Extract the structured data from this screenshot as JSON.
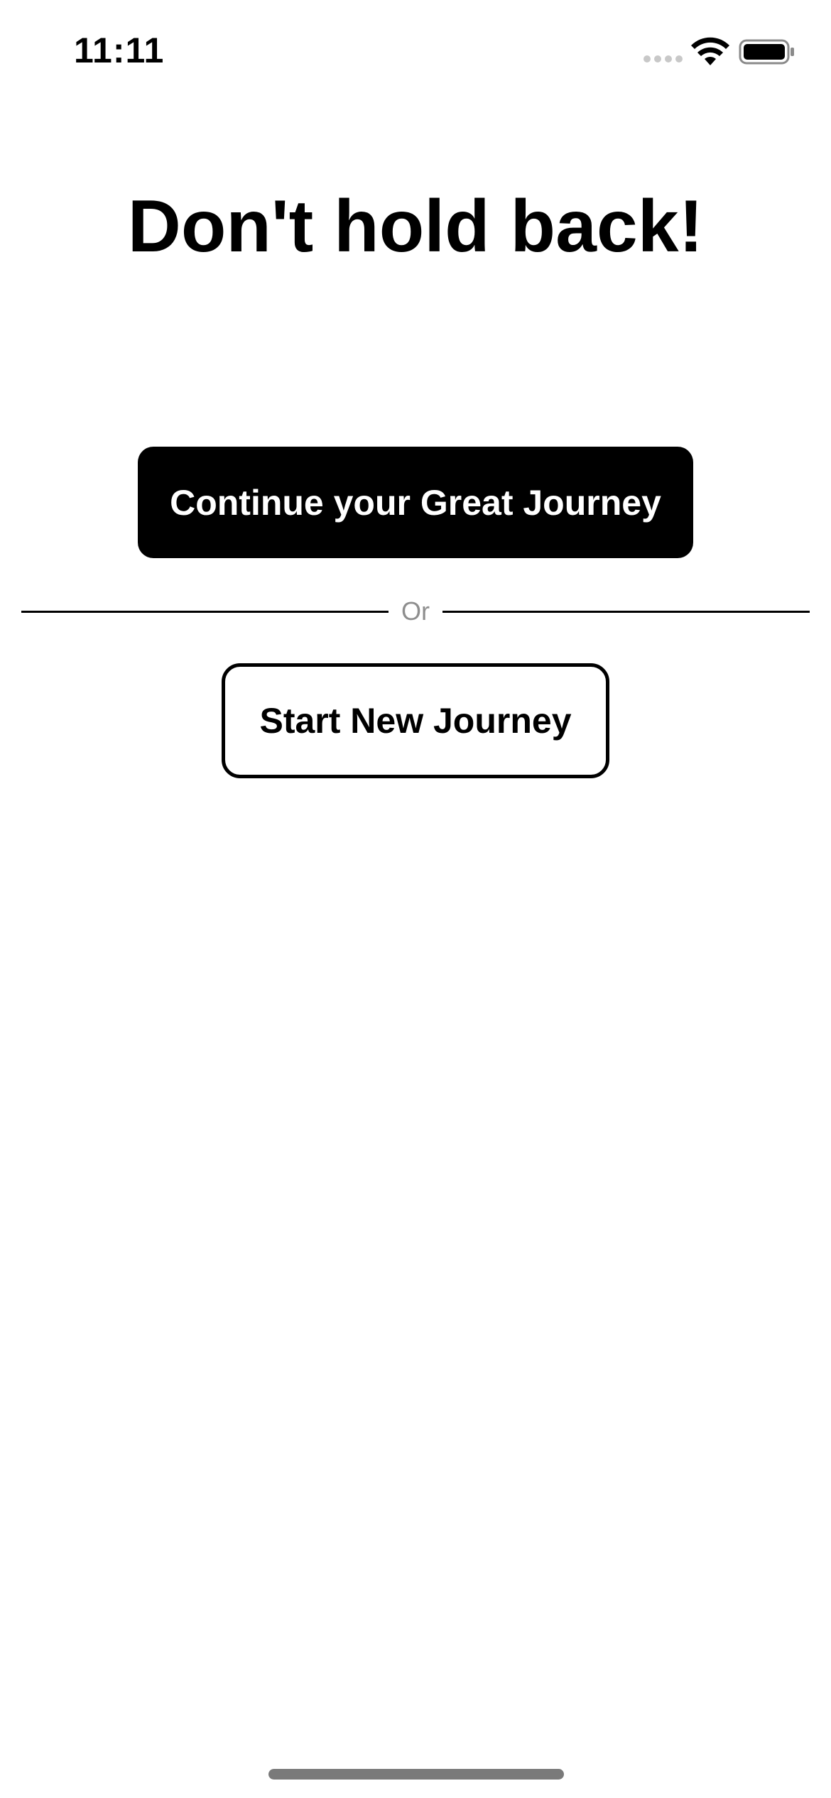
{
  "status_bar": {
    "time": "11:11",
    "icons": [
      "signal-dots-icon",
      "wifi-icon",
      "battery-icon"
    ]
  },
  "main": {
    "title": "Don't hold back!",
    "continue_button_label": "Continue your Great Journey",
    "divider_text": "Or",
    "start_button_label": "Start New Journey"
  },
  "colors": {
    "background": "#ffffff",
    "primary": "#000000",
    "primary_text": "#ffffff",
    "divider_text": "#8e8e8e"
  }
}
